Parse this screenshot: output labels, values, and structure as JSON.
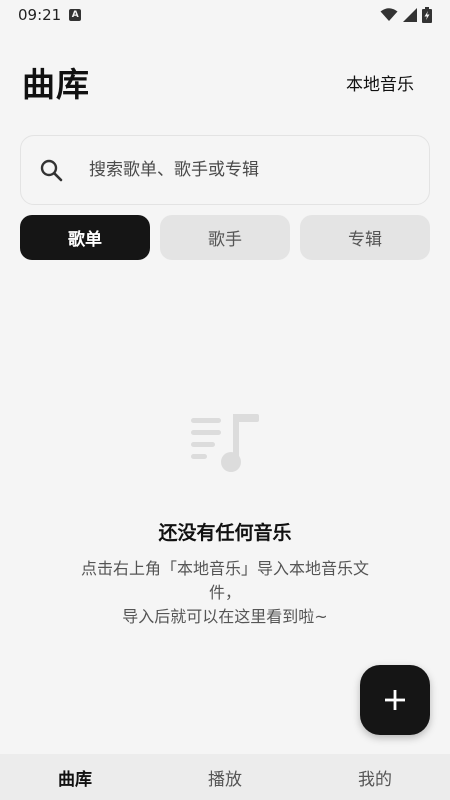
{
  "status_bar": {
    "time": "09:21",
    "notification_icon": "a-letter-icon",
    "wifi_icon": "wifi-icon",
    "signal_icon": "signal-icon",
    "battery_icon": "battery-charging-icon"
  },
  "header": {
    "title": "曲库",
    "local_music": "本地音乐"
  },
  "search": {
    "placeholder": "搜索歌单、歌手或专辑",
    "icon": "search-icon"
  },
  "tabs": [
    {
      "label": "歌单",
      "active": true
    },
    {
      "label": "歌手",
      "active": false
    },
    {
      "label": "专辑",
      "active": false
    }
  ],
  "empty_state": {
    "icon": "playlist-music-icon",
    "title": "还没有任何音乐",
    "desc_line1": "点击右上角「本地音乐」导入本地音乐文",
    "desc_line2": "件，",
    "desc_line3": "导入后就可以在这里看到啦~"
  },
  "fab": {
    "icon": "plus-icon"
  },
  "bottom_nav": [
    {
      "label": "曲库",
      "active": true
    },
    {
      "label": "播放",
      "active": false
    },
    {
      "label": "我的",
      "active": false
    }
  ],
  "colors": {
    "background": "#f5f5f5",
    "primary_dark": "#151515",
    "tab_inactive": "#e4e4e4",
    "nav_background": "#ececec"
  }
}
